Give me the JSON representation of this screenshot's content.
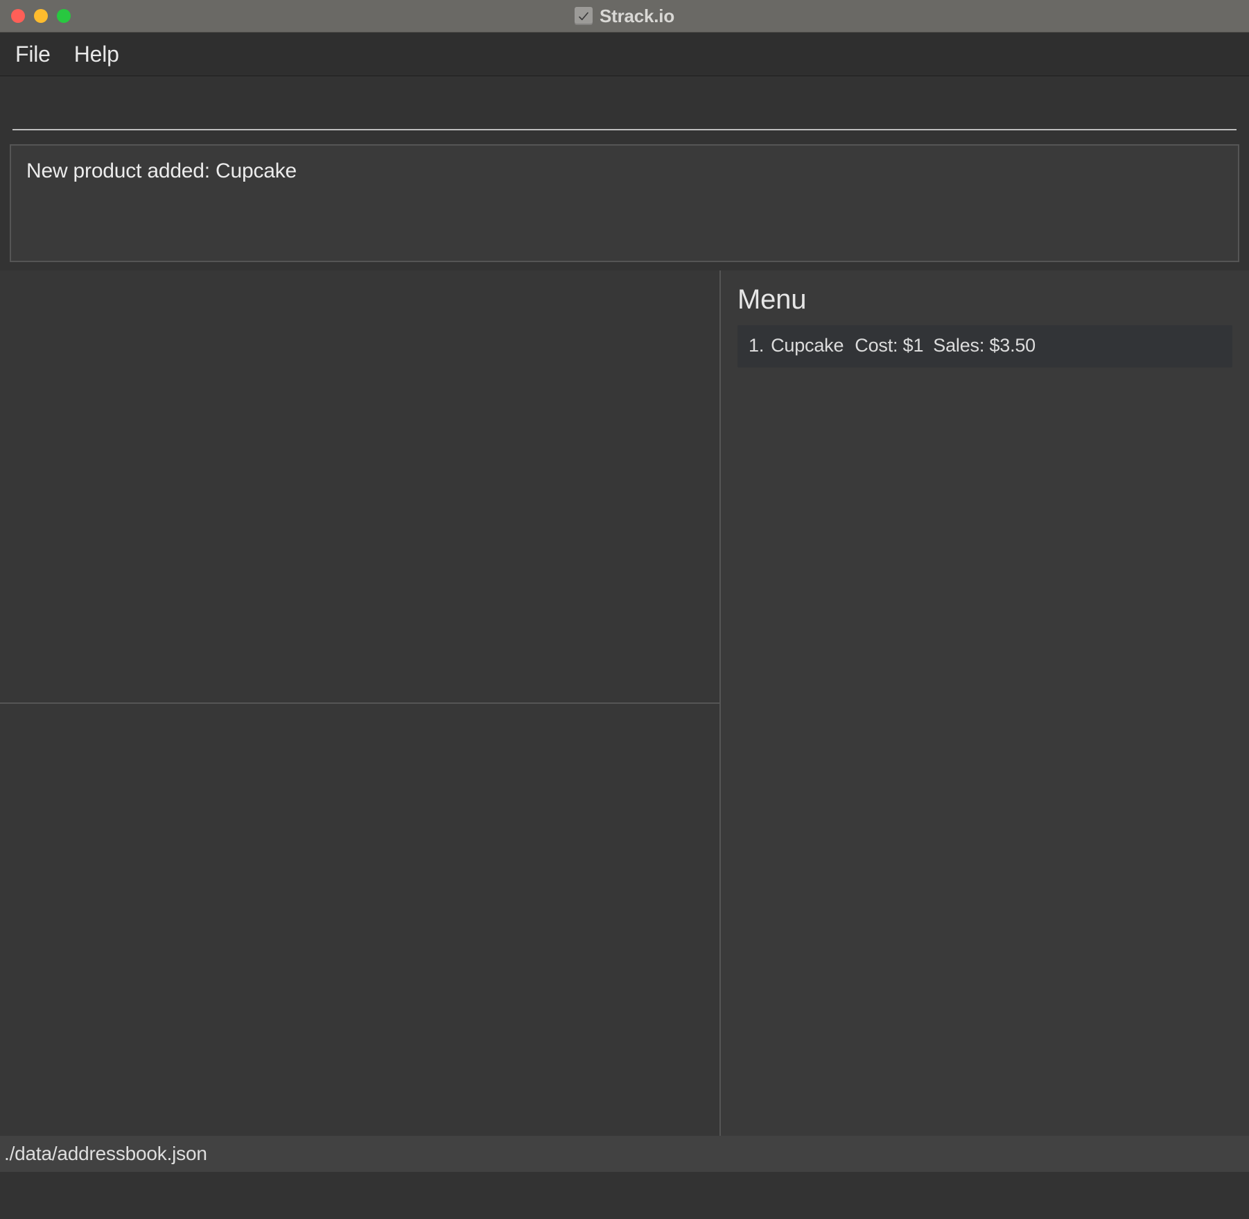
{
  "window": {
    "title": "Strack.io"
  },
  "menubar": {
    "file": "File",
    "help": "Help"
  },
  "notification": {
    "message": "New product added: Cupcake"
  },
  "right_panel": {
    "header": "Menu",
    "items": [
      {
        "index": "1.",
        "name": "Cupcake",
        "cost_label": "Cost:",
        "cost": "$1",
        "sales_label": "Sales:",
        "sales": "$3.50"
      }
    ]
  },
  "statusbar": {
    "path": "./data/addressbook.json"
  }
}
